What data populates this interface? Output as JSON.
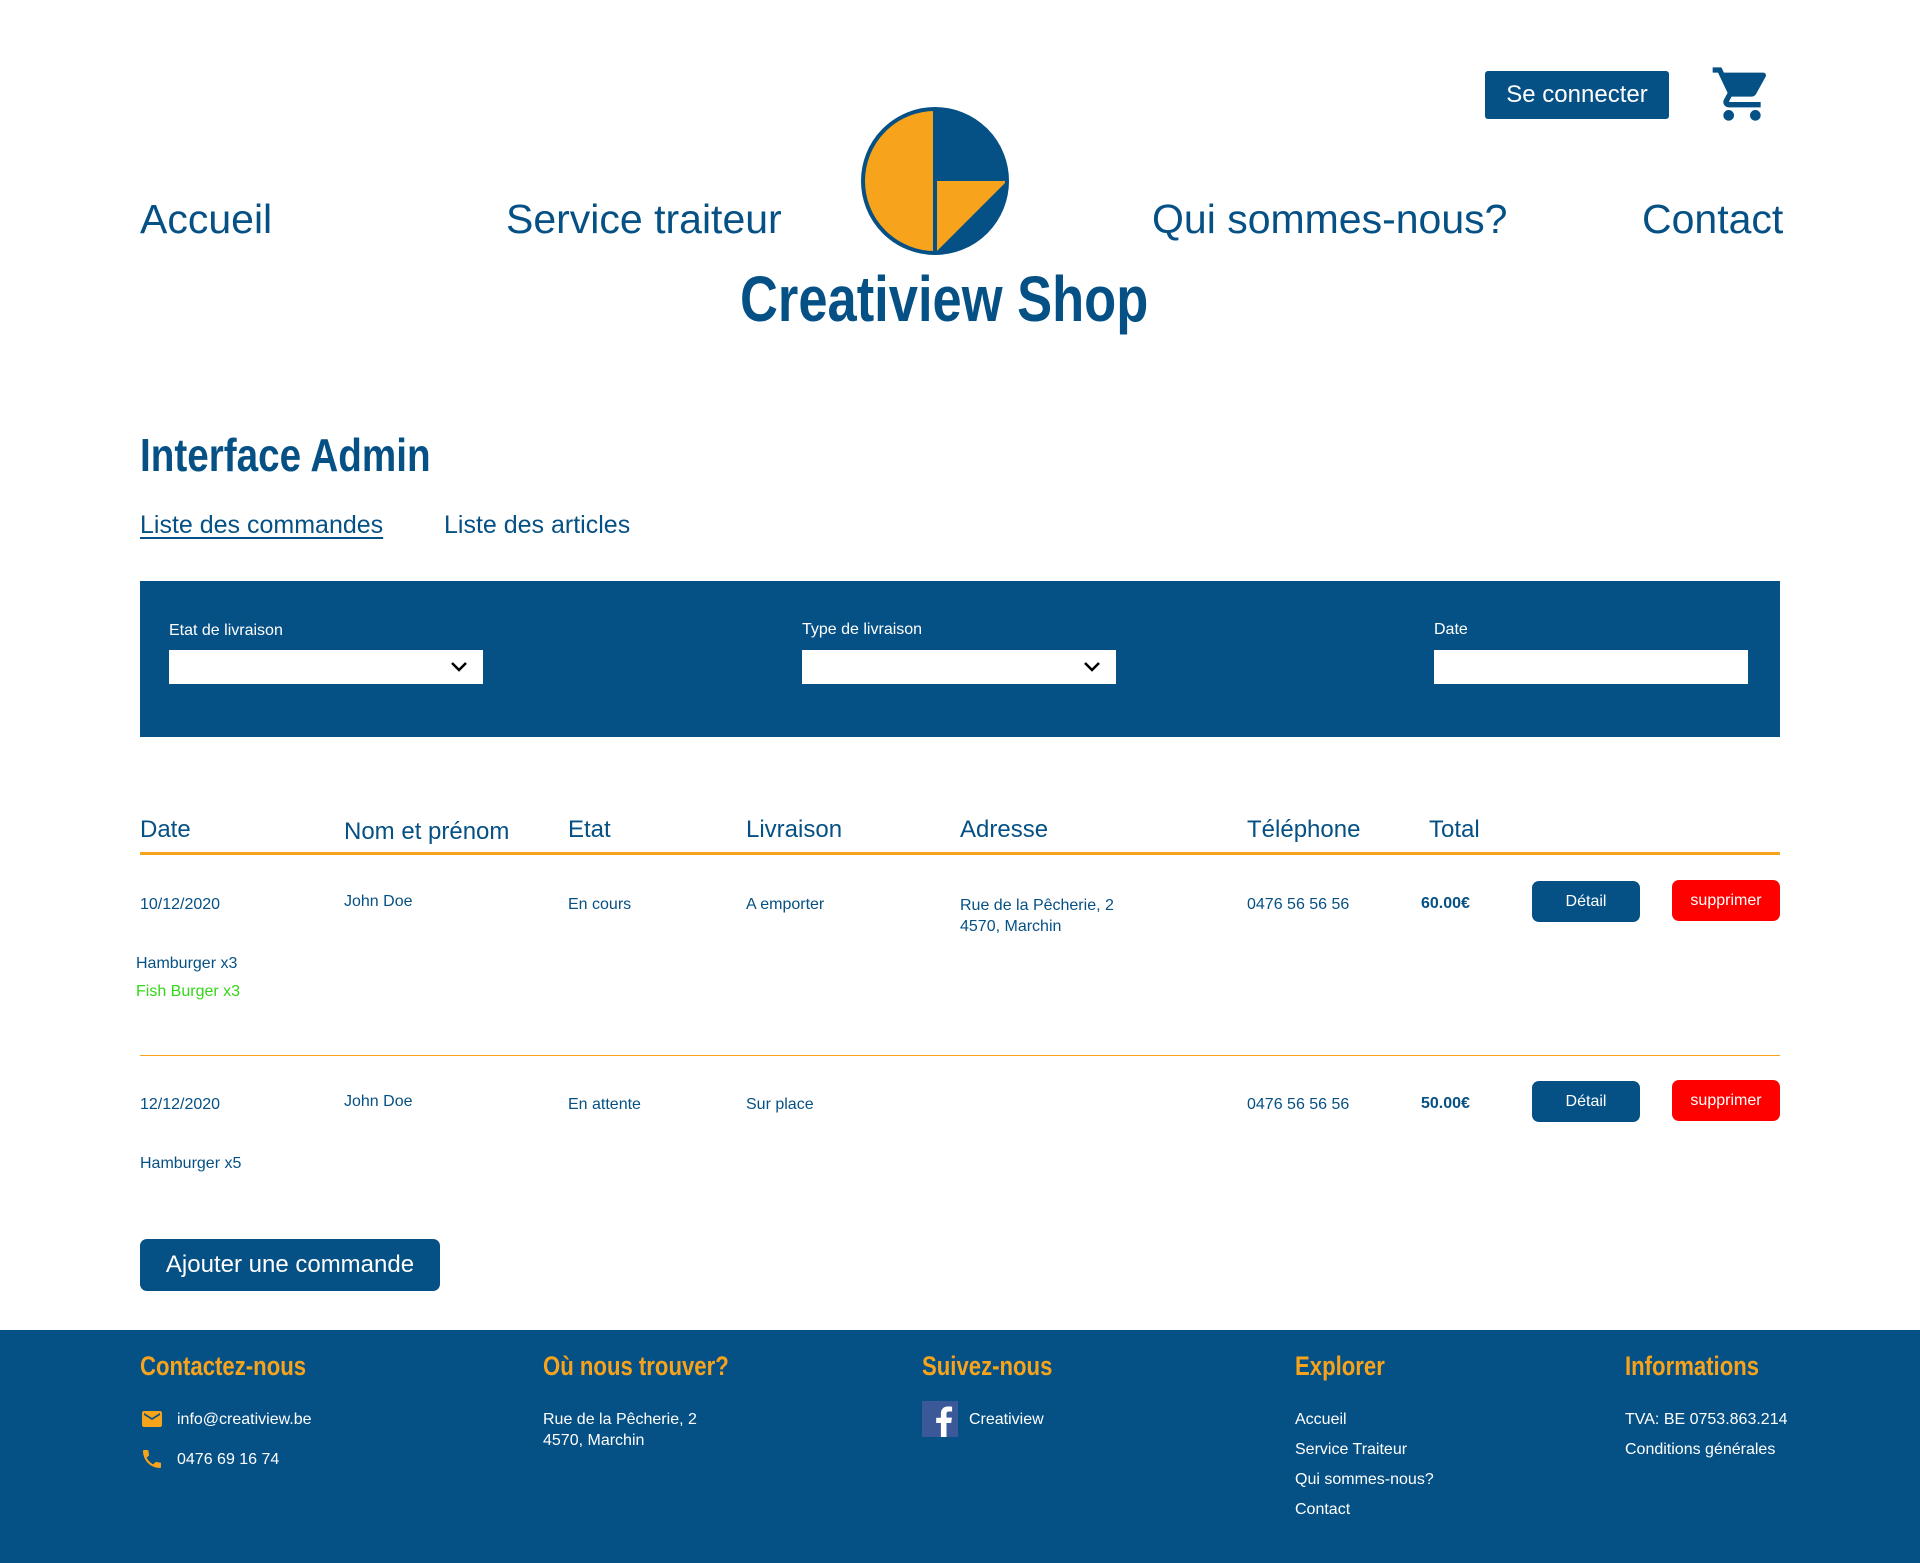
{
  "header": {
    "login_label": "Se connecter",
    "nav": [
      "Accueil",
      "Service traiteur",
      "Qui sommes-nous?",
      "Contact"
    ],
    "brand": "Creatiview Shop"
  },
  "admin": {
    "title": "Interface Admin",
    "tabs": [
      {
        "label": "Liste des commandes",
        "active": true
      },
      {
        "label": "Liste des articles",
        "active": false
      }
    ],
    "filters": {
      "delivery_state_label": "Etat de livraison",
      "delivery_type_label": "Type de livraison",
      "date_label": "Date"
    }
  },
  "table": {
    "headers": [
      "Date",
      "Nom et prénom",
      "Etat",
      "Livraison",
      "Adresse",
      "Téléphone",
      "Total"
    ],
    "detail_label": "Détail",
    "delete_label": "supprimer",
    "rows": [
      {
        "date": "10/12/2020",
        "name": "John Doe",
        "state": "En cours",
        "delivery": "A emporter",
        "address_line1": "Rue de la Pêcherie, 2",
        "address_line2": "4570, Marchin",
        "phone": "0476 56 56 56",
        "total": "60.00€",
        "items": [
          "Hamburger x3",
          "Fish Burger x3"
        ]
      },
      {
        "date": "12/12/2020",
        "name": "John Doe",
        "state": "En attente",
        "delivery": "Sur place",
        "address_line1": "",
        "address_line2": "",
        "phone": "0476 56 56 56",
        "total": "50.00€",
        "items": [
          "Hamburger x5"
        ]
      }
    ],
    "add_label": "Ajouter une commande"
  },
  "footer": {
    "contact": {
      "title": "Contactez-nous",
      "email": "info@creatiview.be",
      "phone": "0476 69 16 74"
    },
    "location": {
      "title": "Où nous trouver?",
      "line1": "Rue de la Pêcherie, 2",
      "line2": "4570, Marchin"
    },
    "social": {
      "title": "Suivez-nous",
      "facebook": "Creatiview"
    },
    "explore": {
      "title": "Explorer",
      "links": [
        "Accueil",
        "Service Traiteur",
        "Qui sommes-nous?",
        "Contact"
      ]
    },
    "info": {
      "title": "Informations",
      "vat": "TVA: BE 0753.863.214",
      "terms": "Conditions générales"
    }
  },
  "colors": {
    "primary": "#055084",
    "accent": "#F7A31C",
    "danger": "#ff0000",
    "highlight": "#34d618"
  },
  "icons": [
    "cart-icon",
    "logo-icon",
    "chevron-down-icon",
    "mail-icon",
    "phone-icon",
    "facebook-icon"
  ]
}
